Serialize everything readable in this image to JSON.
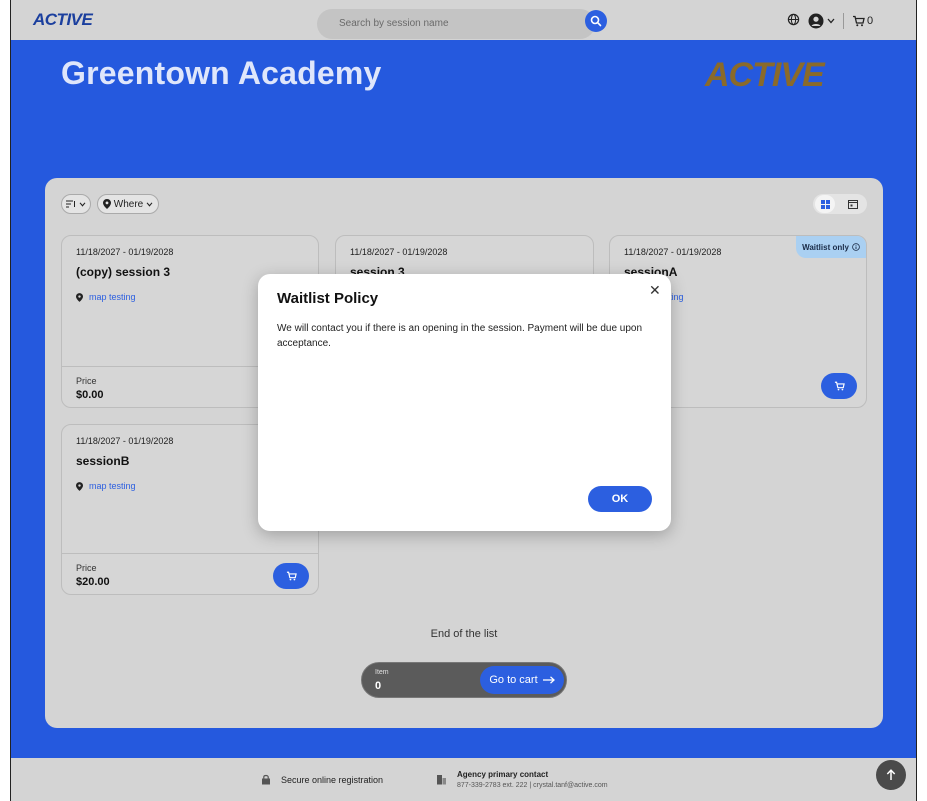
{
  "header": {
    "logo": "ACTIVE",
    "search_placeholder": "Search by session name",
    "cart_count": "0"
  },
  "hero": {
    "title": "Greentown Academy",
    "logo": "ACTIVE"
  },
  "filters": {
    "where_label": "Where"
  },
  "sessions": [
    {
      "dates": "11/18/2027 - 01/19/2028",
      "name": "(copy) session 3",
      "location": "map testing",
      "price_label": "Price",
      "price": "$0.00"
    },
    {
      "dates": "11/18/2027 - 01/19/2028",
      "name": "session 3"
    },
    {
      "dates": "11/18/2027 - 01/19/2028",
      "name": "sessionA",
      "location": "map testing",
      "badge": "Waitlist only"
    },
    {
      "dates": "11/18/2027 - 01/19/2028",
      "name": "sessionB",
      "location": "map testing",
      "price_label": "Price",
      "price": "$20.00"
    }
  ],
  "list_end": "End of the list",
  "cart_bar": {
    "item_label": "Item",
    "item_count": "0",
    "button_label": "Go to cart"
  },
  "footer": {
    "secure_label": "Secure online registration",
    "contact_title": "Agency primary contact",
    "contact_info": "877-339-2783 ext. 222  |  crystal.tanf@active.com"
  },
  "modal": {
    "title": "Waitlist Policy",
    "body": "We will contact you if there is an opening in the session. Payment will be due upon acceptance.",
    "ok_label": "OK"
  },
  "colors": {
    "brand_blue": "#2559de",
    "button_blue": "#2c5fe0",
    "waitlist_badge": "#aad0f2"
  }
}
